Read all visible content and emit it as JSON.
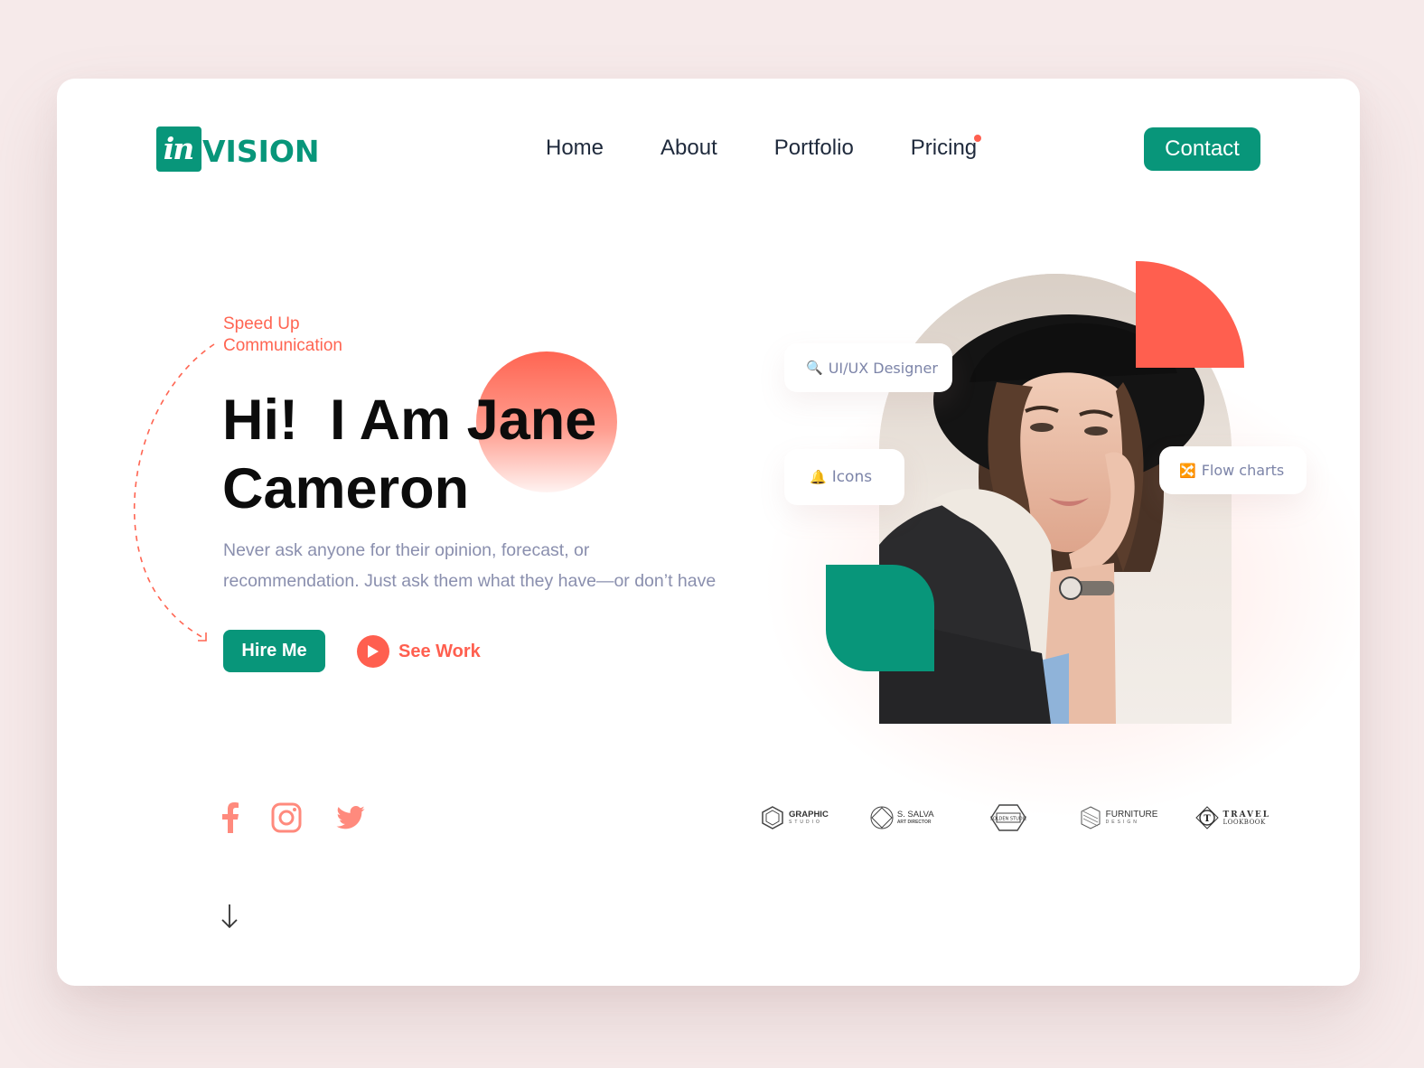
{
  "logo": {
    "mark": "in",
    "text": "VISION",
    "brand_color": "#08967a"
  },
  "nav": {
    "items": [
      {
        "label": "Home",
        "badge": false
      },
      {
        "label": "About",
        "badge": false
      },
      {
        "label": "Portfolio",
        "badge": false
      },
      {
        "label": "Pricing",
        "badge": true
      }
    ],
    "contact_label": "Contact"
  },
  "hero": {
    "tagline_line1": "Speed Up",
    "tagline_line2": "Communication",
    "title_line1": "Hi!  I Am Jane",
    "title_line2": "Cameron",
    "description_line1": "Never ask anyone for their opinion, forecast, or",
    "description_line2": "recommendation. Just ask them what they have—or don’t have",
    "hire_label": "Hire Me",
    "see_work_label": "See Work"
  },
  "chips": [
    {
      "icon": "magnifier-icon",
      "glyph": "🔍",
      "label": "UI/UX Designer"
    },
    {
      "icon": "bell-icon",
      "glyph": "🔔",
      "label": "Icons"
    },
    {
      "icon": "shuffle-icon",
      "glyph": "🔀",
      "label": "Flow charts"
    }
  ],
  "socials": [
    "facebook",
    "instagram",
    "twitter"
  ],
  "brands": [
    {
      "name": "GRAPHIC",
      "sub": "STUDIO"
    },
    {
      "name": "S. SALVA",
      "sub": "ART DIRECTOR"
    },
    {
      "name": "GOLDEN STUDIO",
      "sub": ""
    },
    {
      "name": "FURNITURE",
      "sub": "DESIGN"
    },
    {
      "name": "TRAVEL",
      "sub": "LOOKBOOK"
    }
  ],
  "colors": {
    "accent_green": "#08967a",
    "accent_coral": "#ff5f4f",
    "social_pink": "#ff8a7d",
    "text_muted": "#8a8fae",
    "page_bg": "#f6eaea"
  }
}
